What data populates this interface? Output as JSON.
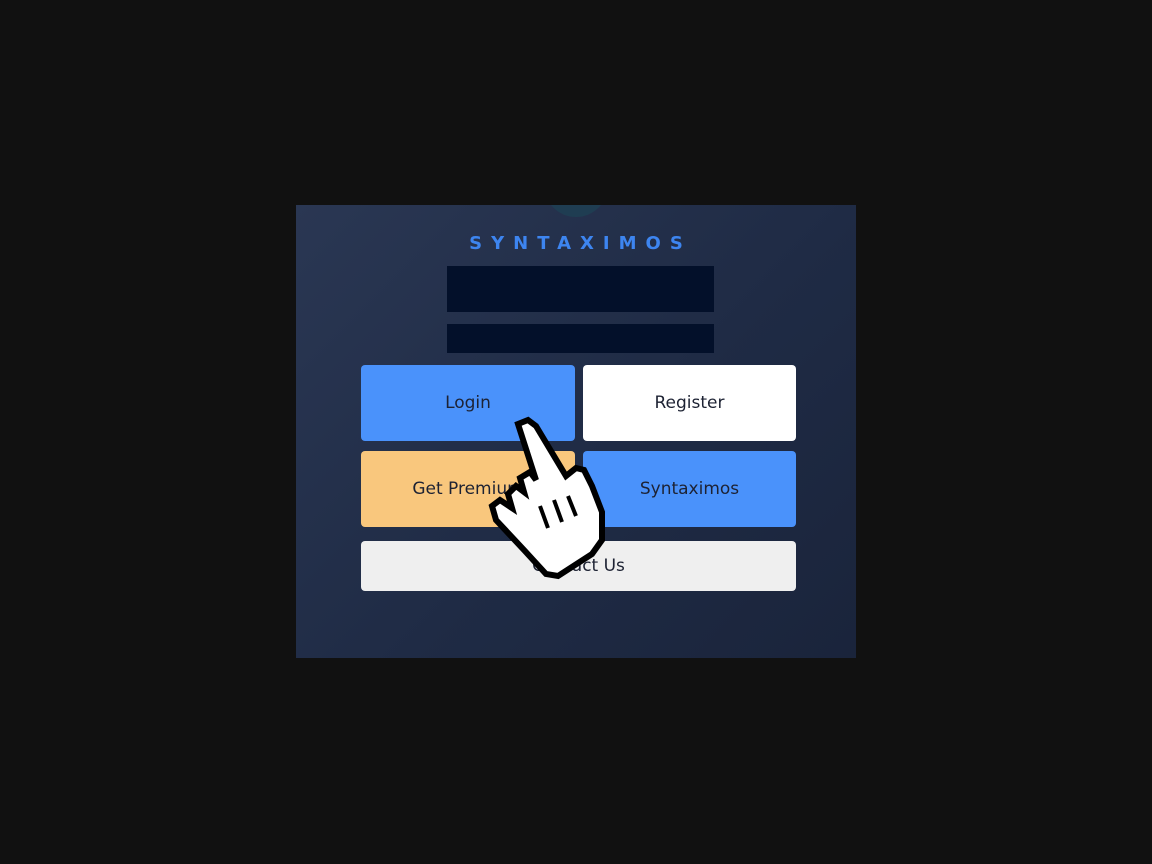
{
  "brand": {
    "title": "SYNTAXIMOS",
    "accent_color": "#3d85f0"
  },
  "form": {
    "username_placeholder": "",
    "password_placeholder": ""
  },
  "buttons": {
    "login": "Login",
    "register": "Register",
    "premium": "Get Premium",
    "syntaximos": "Syntaximos",
    "contact": "Contact Us"
  },
  "colors": {
    "background": "#111111",
    "panel": "#243049",
    "input": "#03102a",
    "blue_button": "#4a92fb",
    "white_button": "#ffffff",
    "premium_button": "#f9c77d",
    "contact_button": "#efefef"
  },
  "cursor": {
    "icon": "hand-pointer-cursor-icon"
  }
}
